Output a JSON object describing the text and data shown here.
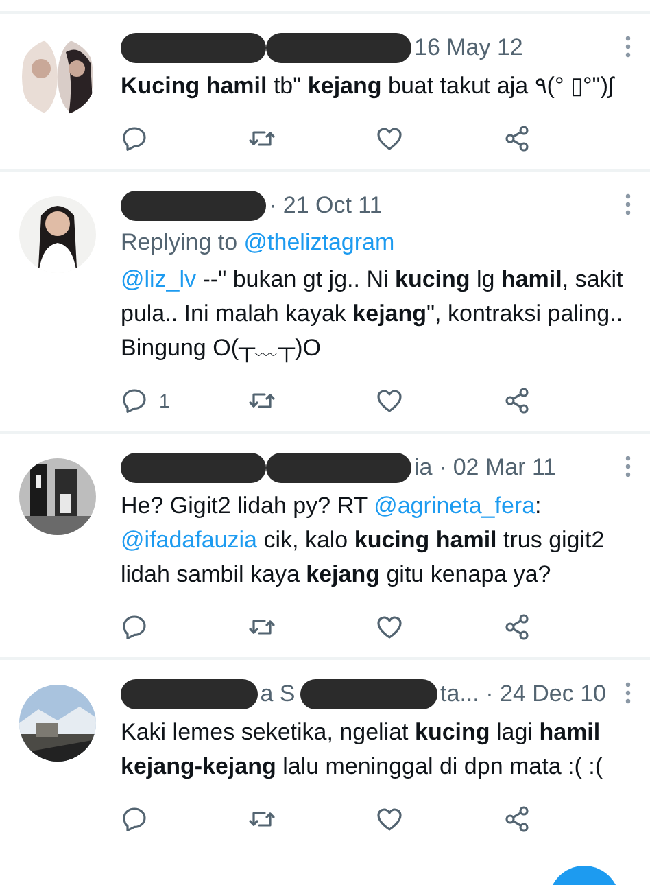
{
  "tweets": [
    {
      "avatar": {
        "kind": "picture"
      },
      "header": [
        {
          "kind": "redacted"
        },
        {
          "kind": "redacted"
        },
        {
          "kind": "text",
          "text": "16 May 12"
        }
      ],
      "body": [
        {
          "kind": "text",
          "text": "**Kucing hamil** tb\" **kejang** buat takut aja ٩(° ▯°\")ʃ"
        }
      ]
    },
    {
      "avatar": {
        "kind": "picture"
      },
      "header": [
        {
          "kind": "redacted"
        },
        {
          "kind": "text",
          "text": "· 21 Oct 11"
        }
      ],
      "replying_to": {
        "label": "Replying to",
        "mention": "@theliztagram"
      },
      "body": [
        {
          "kind": "mention",
          "text": "@liz_lv"
        },
        {
          "kind": "text",
          "text": " --\" bukan gt jg.. Ni **kucing** lg **hamil**, sakit pula.. Ini malah kayak **kejang**\", kontraksi paling.. Bingung O(┬﹏┬)O"
        }
      ],
      "reply_count": "1"
    },
    {
      "avatar": {
        "kind": "picture"
      },
      "header": [
        {
          "kind": "redacted"
        },
        {
          "kind": "redacted"
        },
        {
          "kind": "text",
          "text": "ia · 02 Mar 11"
        }
      ],
      "body": [
        {
          "kind": "text",
          "text": "He? Gigit2 lidah py? RT "
        },
        {
          "kind": "mention",
          "text": "@agrineta_fera"
        },
        {
          "kind": "text",
          "text": ": "
        },
        {
          "kind": "mention",
          "text": "@ifadafauzia"
        },
        {
          "kind": "text",
          "text": " cik, kalo **kucing hamil** trus gigit2 lidah sambil kaya **kejang** gitu kenapa ya?"
        }
      ]
    },
    {
      "avatar": {
        "kind": "picture"
      },
      "header": [
        {
          "kind": "redacted"
        },
        {
          "kind": "text",
          "text": "a S"
        },
        {
          "kind": "redacted"
        },
        {
          "kind": "text",
          "text": "ta... · 24 Dec 10"
        }
      ],
      "body": [
        {
          "kind": "text",
          "text": "Kaki lemes seketika, ngeliat **kucing** lagi **hamil kejang-kejang** lalu meninggal di dpn mata :( :("
        }
      ]
    }
  ]
}
